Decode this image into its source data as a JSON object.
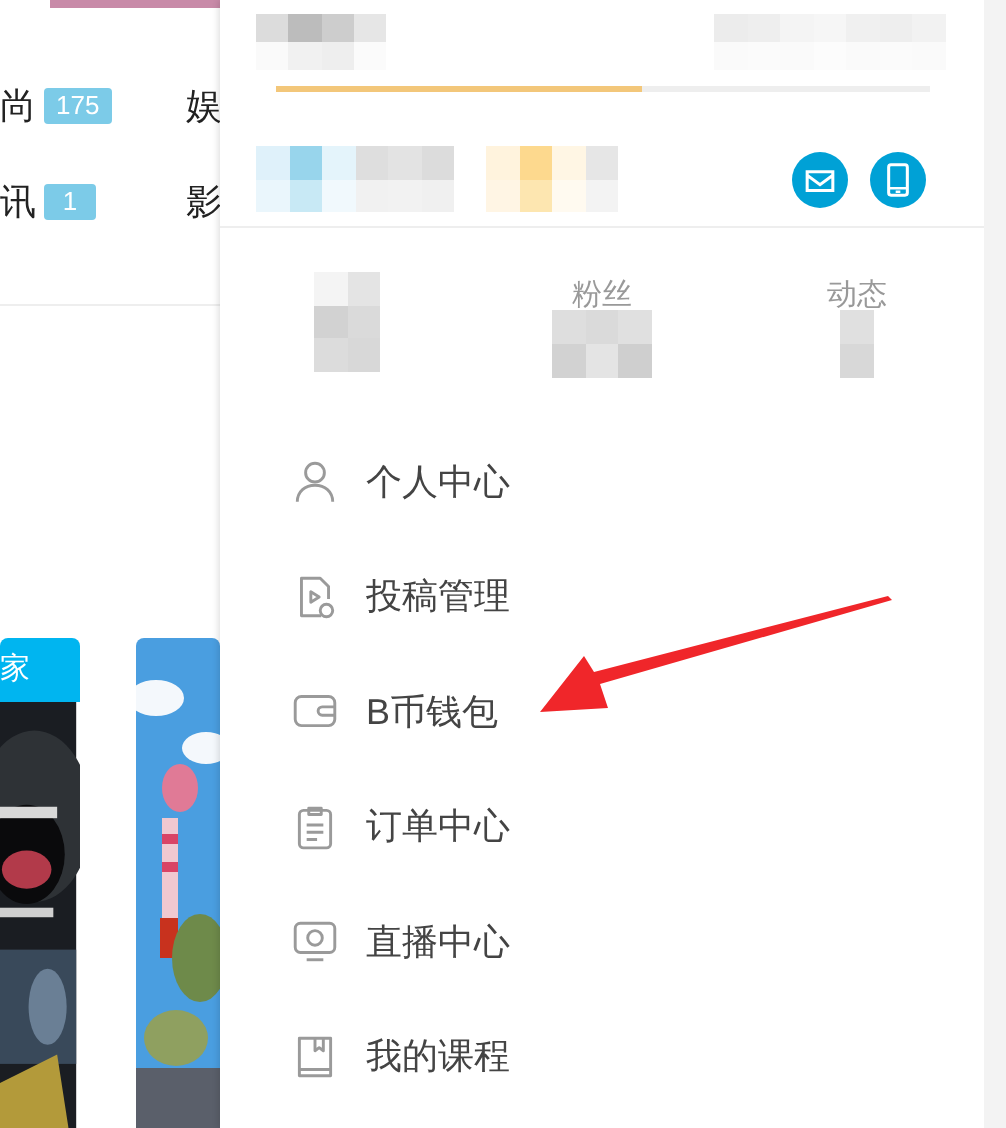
{
  "page": {
    "categories": [
      {
        "label": "尚",
        "count": "175"
      },
      {
        "label": "娱"
      },
      {
        "label": "讯",
        "count": "1"
      },
      {
        "label": "影"
      }
    ],
    "cards": [
      {
        "header": "家",
        "kind": "picture"
      },
      {
        "kind": "picture"
      }
    ]
  },
  "user_menu": {
    "level_bar": {
      "level": 0.56
    },
    "stats": [
      {
        "label": "粉丝"
      },
      {
        "label": "动态"
      }
    ],
    "items": [
      {
        "label": "个人中心"
      },
      {
        "label": "投稿管理"
      },
      {
        "label": "B币钱包"
      },
      {
        "label": "订单中心"
      },
      {
        "label": "直播中心"
      },
      {
        "label": "我的课程"
      }
    ]
  }
}
